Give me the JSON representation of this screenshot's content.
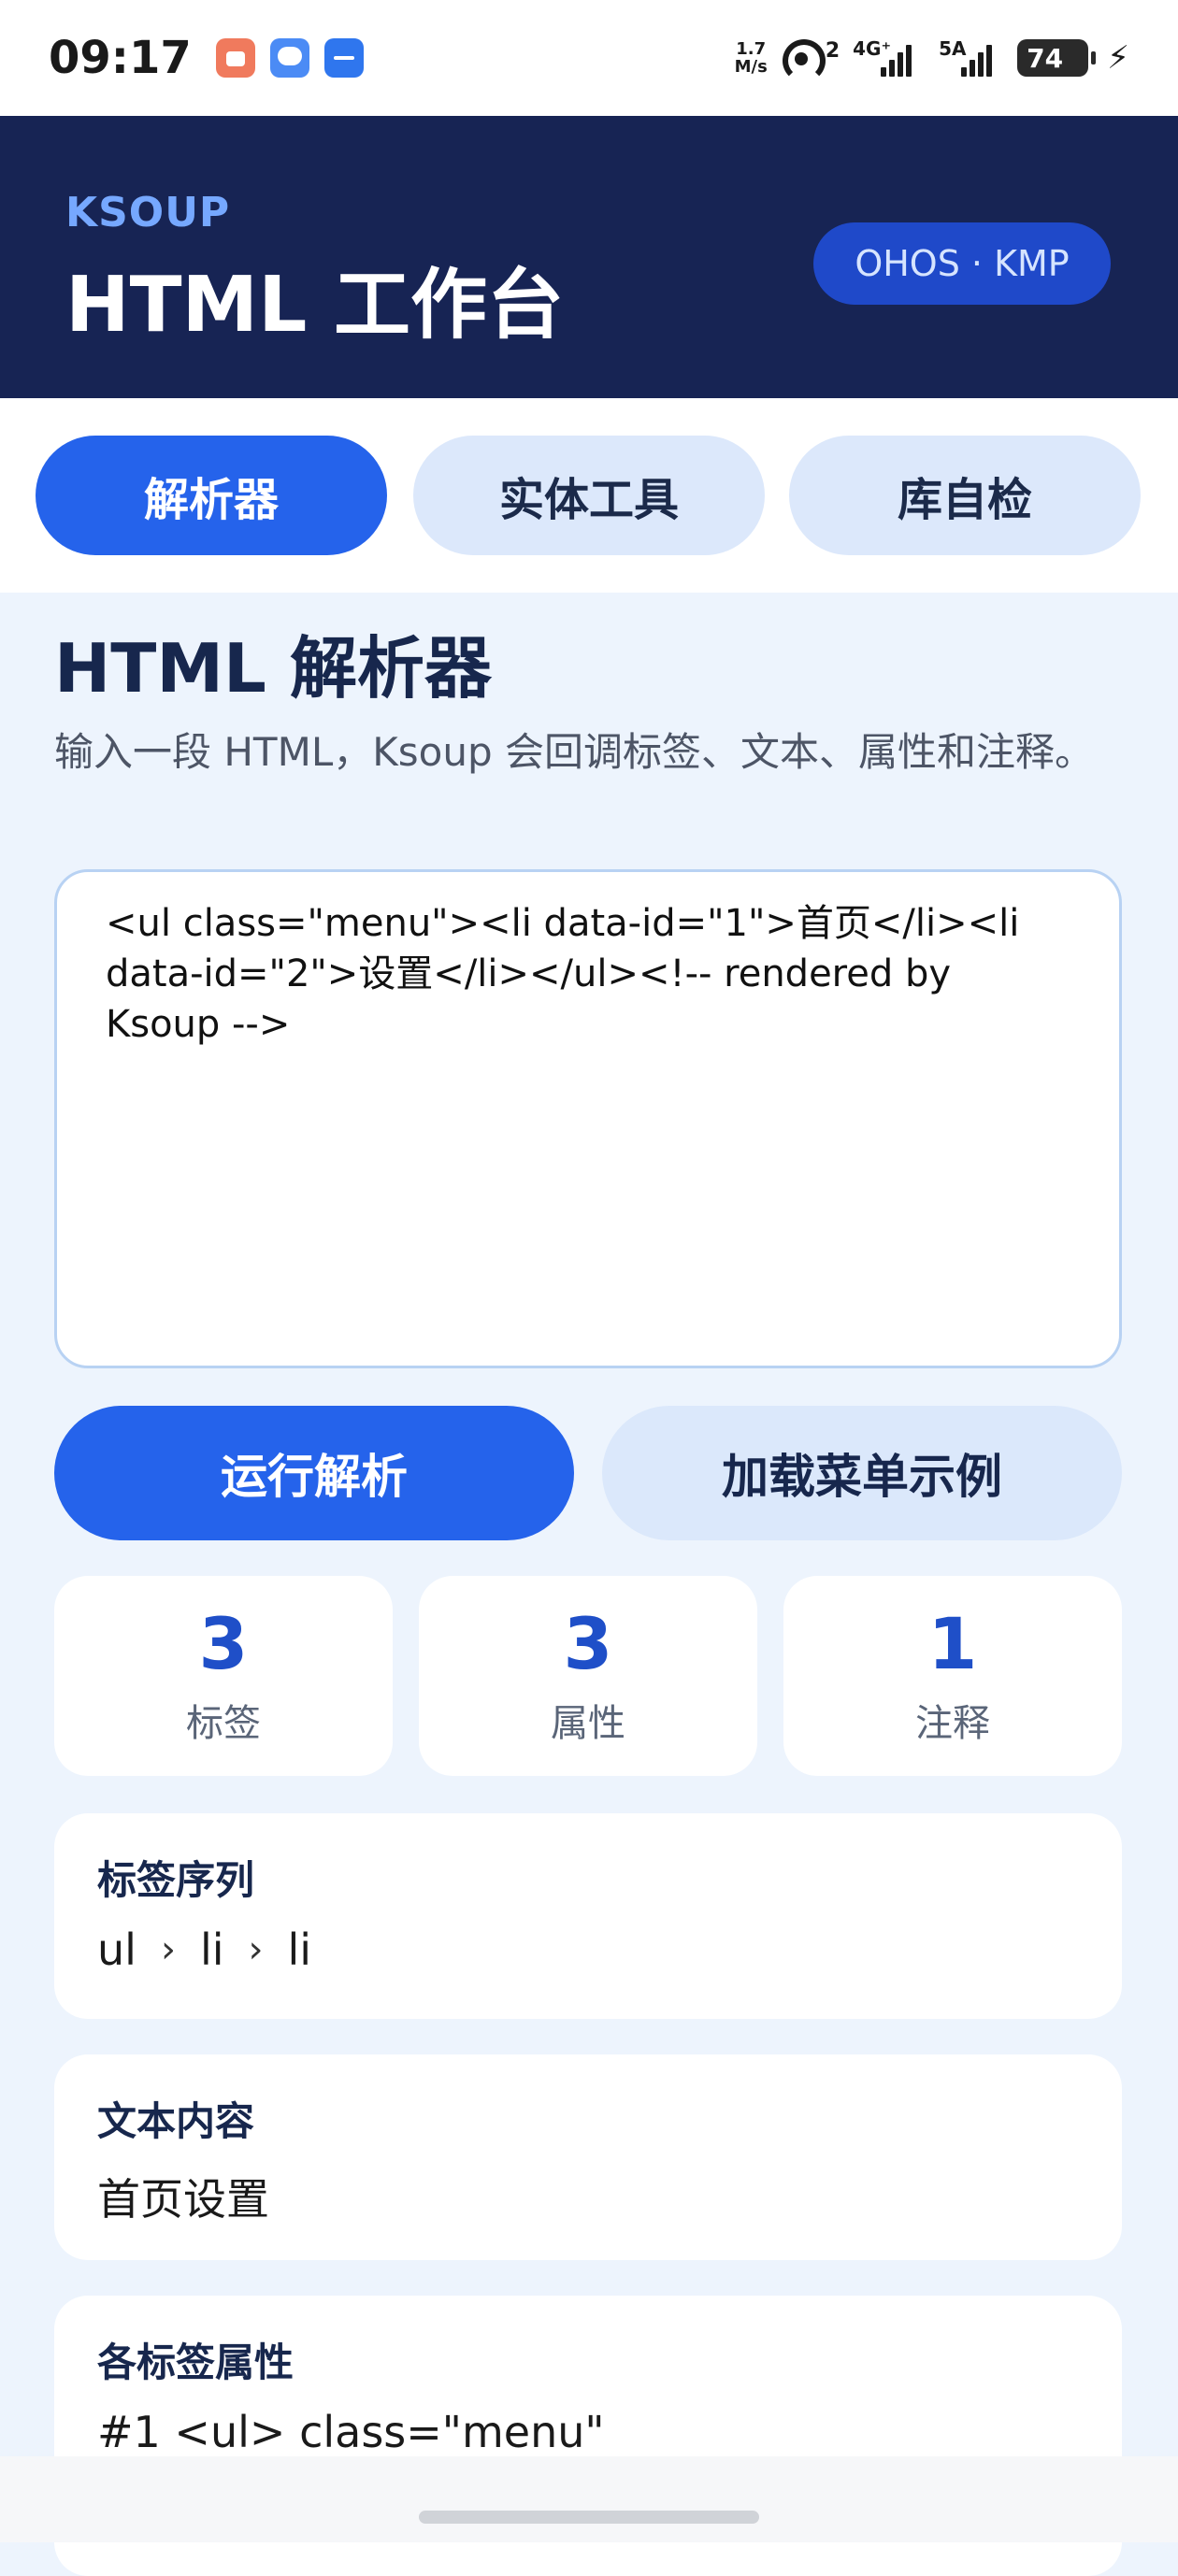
{
  "status_bar": {
    "time": "09:17",
    "net_speed_value": "1.7",
    "net_speed_unit": "M/s",
    "hotspot_count": "2",
    "signal1_label": "4G⁺",
    "signal2_label": "5A",
    "battery": "74",
    "notification_icons": [
      "shopping-bag-icon",
      "chat-bubble-icon",
      "usb-icon"
    ]
  },
  "header": {
    "kicker": "KSOUP",
    "title": "HTML 工作台",
    "platform_badge": "OHOS · KMP"
  },
  "tabs": [
    {
      "label": "解析器",
      "active": true
    },
    {
      "label": "实体工具",
      "active": false
    },
    {
      "label": "库自检",
      "active": false
    }
  ],
  "main": {
    "title": "HTML 解析器",
    "description": "输入一段 HTML，Ksoup 会回调标签、文本、属性和注释。",
    "input_value": "<ul class=\"menu\"><li data-id=\"1\">首页</li><li data-id=\"2\">设置</li></ul><!-- rendered by Ksoup -->",
    "run_button": "运行解析",
    "load_example_button": "加载菜单示例",
    "stats": [
      {
        "value": "3",
        "label": "标签"
      },
      {
        "value": "3",
        "label": "属性"
      },
      {
        "value": "1",
        "label": "注释"
      }
    ],
    "tag_sequence": {
      "title": "标签序列",
      "tags": [
        "ul",
        "li",
        "li"
      ],
      "separator": "›"
    },
    "text_content": {
      "title": "文本内容",
      "value": "首页设置"
    },
    "attributes": {
      "title": "各标签属性",
      "first_line": "#1 <ul> class=\"menu\""
    }
  },
  "colors": {
    "header_bg": "#172454",
    "accent": "#2563eb",
    "secondary_bg": "#dbe8fb",
    "page_bg": "#edf4fd"
  }
}
